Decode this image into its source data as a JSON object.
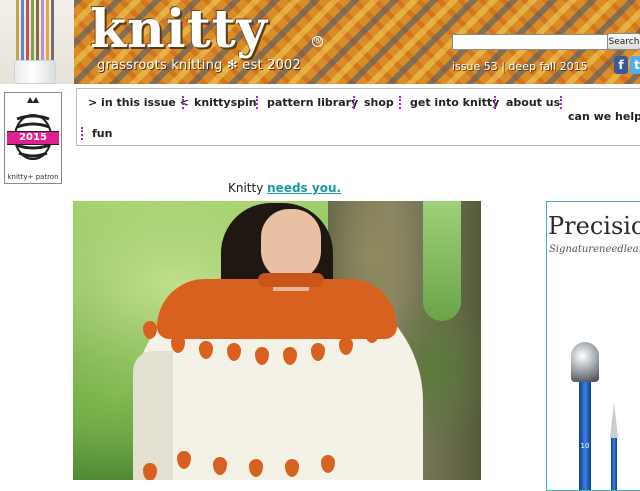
{
  "header": {
    "logo_text": "knitty",
    "logo_reg": "®",
    "tagline": "grassroots knitting ✻ est 2002",
    "search": {
      "placeholder": "",
      "value": "",
      "button_label": "Search"
    },
    "issue_text": "issue 53 | deep fall 2015",
    "social": {
      "facebook": "f",
      "twitter": "t"
    }
  },
  "patron_badge": {
    "year": "2015",
    "label": "knitty+ patron"
  },
  "nav": {
    "items": [
      "> in this issue <",
      "knittyspin",
      "pattern library",
      "shop",
      "get into knitty",
      "about us",
      "can we help?",
      "fun"
    ]
  },
  "main": {
    "needs_prefix": "Knitty ",
    "needs_link": "needs you."
  },
  "ad": {
    "title": "Precision",
    "subtitle": "Signatureneedlearts.com",
    "needle_label": "10"
  },
  "colors": {
    "link_teal": "#1a9aa0",
    "nav_separator": "#9b2dbd",
    "ad_border": "#4bb3b8",
    "patron_pink": "#e0208f",
    "banner_orange": "#d98c28",
    "sweater_orange": "#d9611f"
  }
}
